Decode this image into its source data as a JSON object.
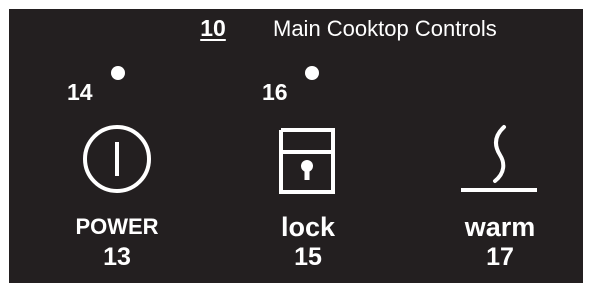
{
  "header": {
    "ref_number": "10",
    "title": "Main Cooktop Controls"
  },
  "indicators": [
    {
      "label": "14"
    },
    {
      "label": "16"
    }
  ],
  "controls": [
    {
      "label": "POWER",
      "number": "13",
      "icon": "power-icon"
    },
    {
      "label": "lock",
      "number": "15",
      "icon": "lock-icon"
    },
    {
      "label": "warm",
      "number": "17",
      "icon": "warm-icon"
    }
  ],
  "colors": {
    "panel_background": "#231f20",
    "foreground": "#ffffff"
  }
}
